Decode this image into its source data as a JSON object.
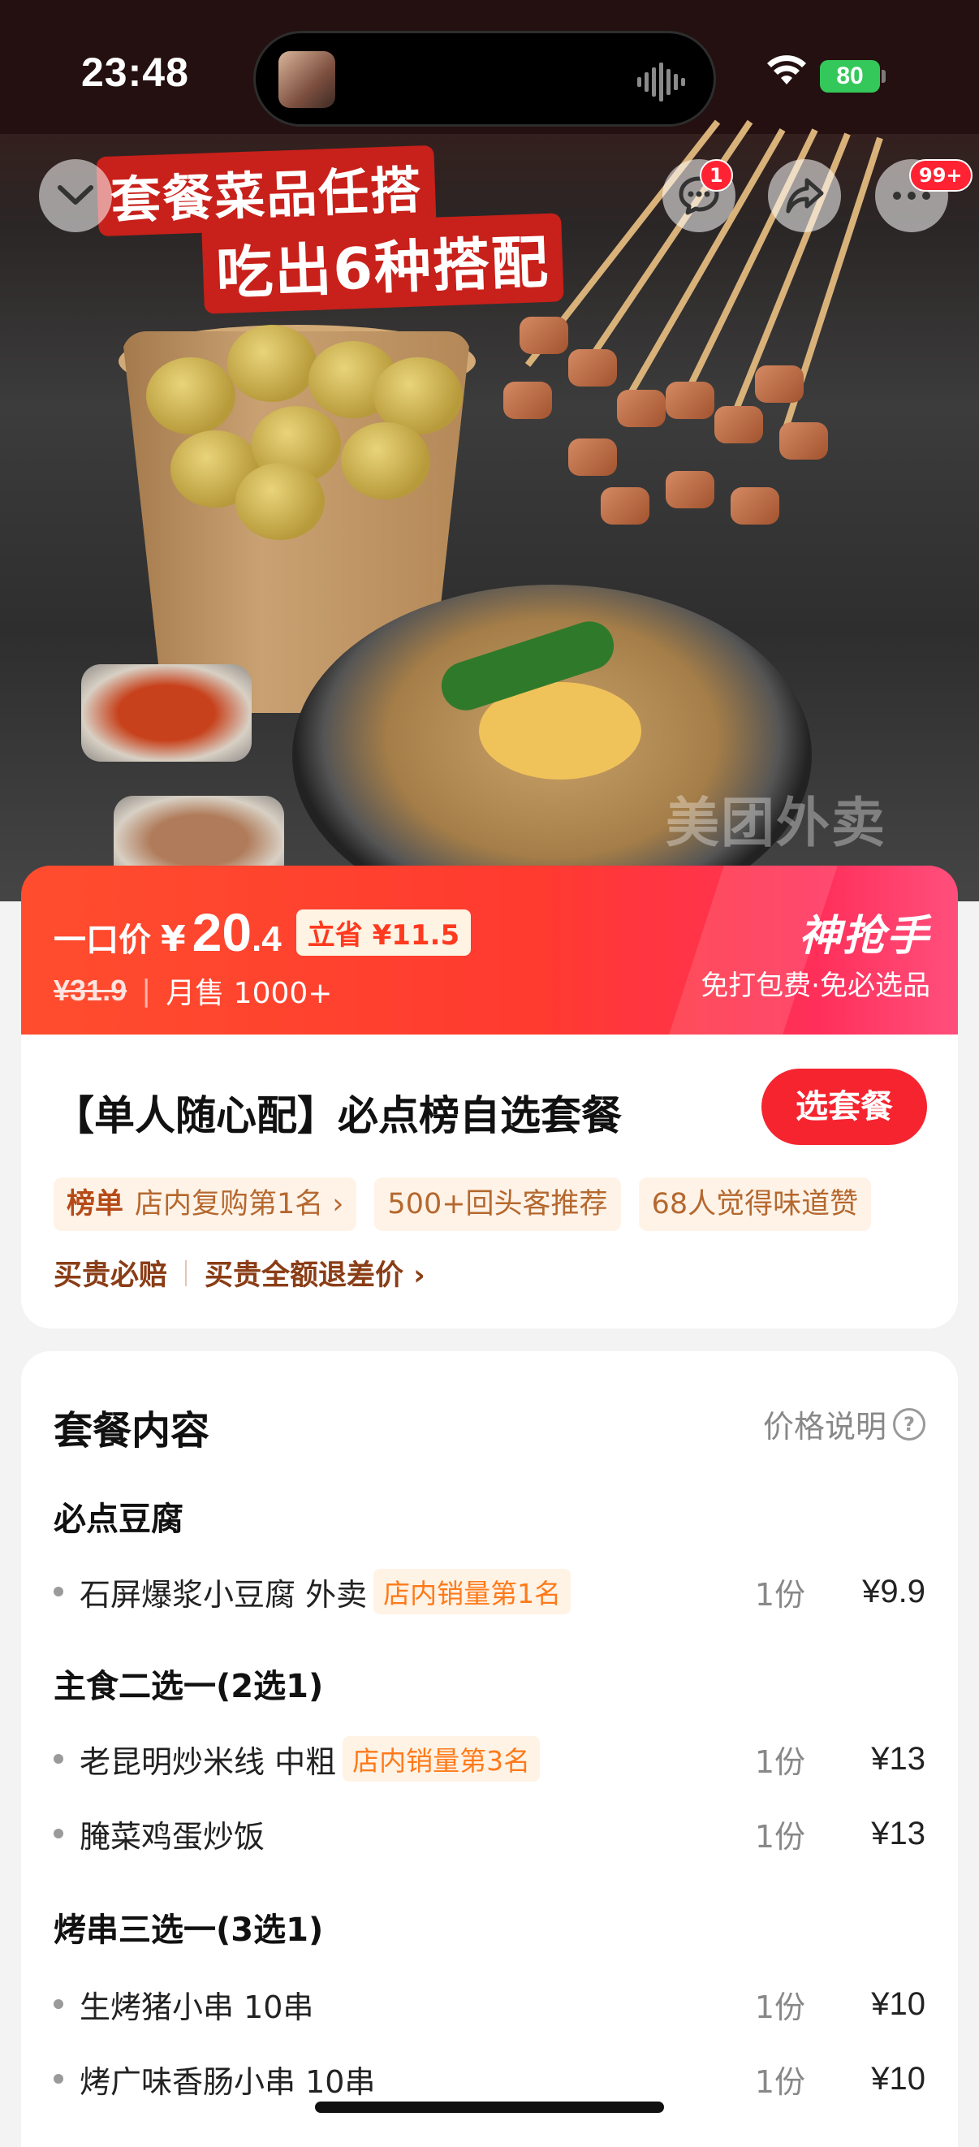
{
  "status": {
    "time": "23:48",
    "battery": "80"
  },
  "hero": {
    "banner_line1": "套餐菜品任搭",
    "banner_line2": "吃出6种搭配",
    "message_badge": "1",
    "more_badge": "99+",
    "watermark": "美团外卖"
  },
  "price": {
    "label": "一口价",
    "currency": "¥",
    "int": "20",
    "dec": ".4",
    "save": "立省 ¥11.5",
    "original": "¥31.9",
    "separator": "|",
    "monthly_sales": "月售 1000+",
    "promo_title": "神抢手",
    "promo_sub": "免打包费·免必选品"
  },
  "product": {
    "title": "【单人随心配】必点榜自选套餐",
    "choose_label": "选套餐",
    "tag_rank_head": "榜单",
    "tag_rank_text": "店内复购第1名 ›",
    "tag_repeat": "500+回头客推荐",
    "tag_taste": "68人觉得味道赞",
    "guarantee_1": "买贵必赔",
    "guarantee_2": "买贵全额退差价 ›"
  },
  "package": {
    "title": "套餐内容",
    "help": "价格说明",
    "help_icon": "?",
    "groups": [
      {
        "title": "必点豆腐",
        "items": [
          {
            "name": "石屏爆浆小豆腐 外卖",
            "rank": "店内销量第1名",
            "qty": "1份",
            "price": "¥9.9"
          }
        ]
      },
      {
        "title": "主食二选一(2选1)",
        "items": [
          {
            "name": "老昆明炒米线 中粗",
            "rank": "店内销量第3名",
            "qty": "1份",
            "price": "¥13"
          },
          {
            "name": "腌菜鸡蛋炒饭",
            "rank": "",
            "qty": "1份",
            "price": "¥13"
          }
        ]
      },
      {
        "title": "烤串三选一(3选1)",
        "items": [
          {
            "name": "生烤猪小串 10串",
            "rank": "",
            "qty": "1份",
            "price": "¥10"
          },
          {
            "name": "烤广味香肠小串 10串",
            "rank": "",
            "qty": "1份",
            "price": "¥10"
          }
        ]
      }
    ]
  },
  "colors": {
    "accent_red": "#f5242f",
    "tag_bg": "#fff3e8",
    "rank_orange": "#ff7a1a"
  }
}
